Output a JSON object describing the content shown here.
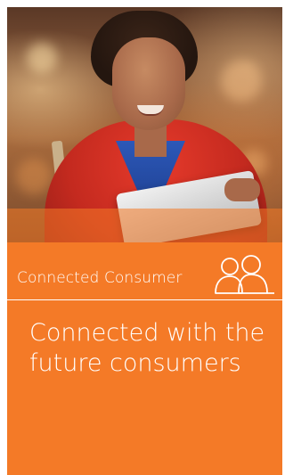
{
  "card": {
    "category": "Connected Consumer",
    "category_icon": "people-icon",
    "headline": "Connected with the future consumers"
  },
  "colors": {
    "accent": "#f47a27",
    "text": "#ffffff"
  }
}
